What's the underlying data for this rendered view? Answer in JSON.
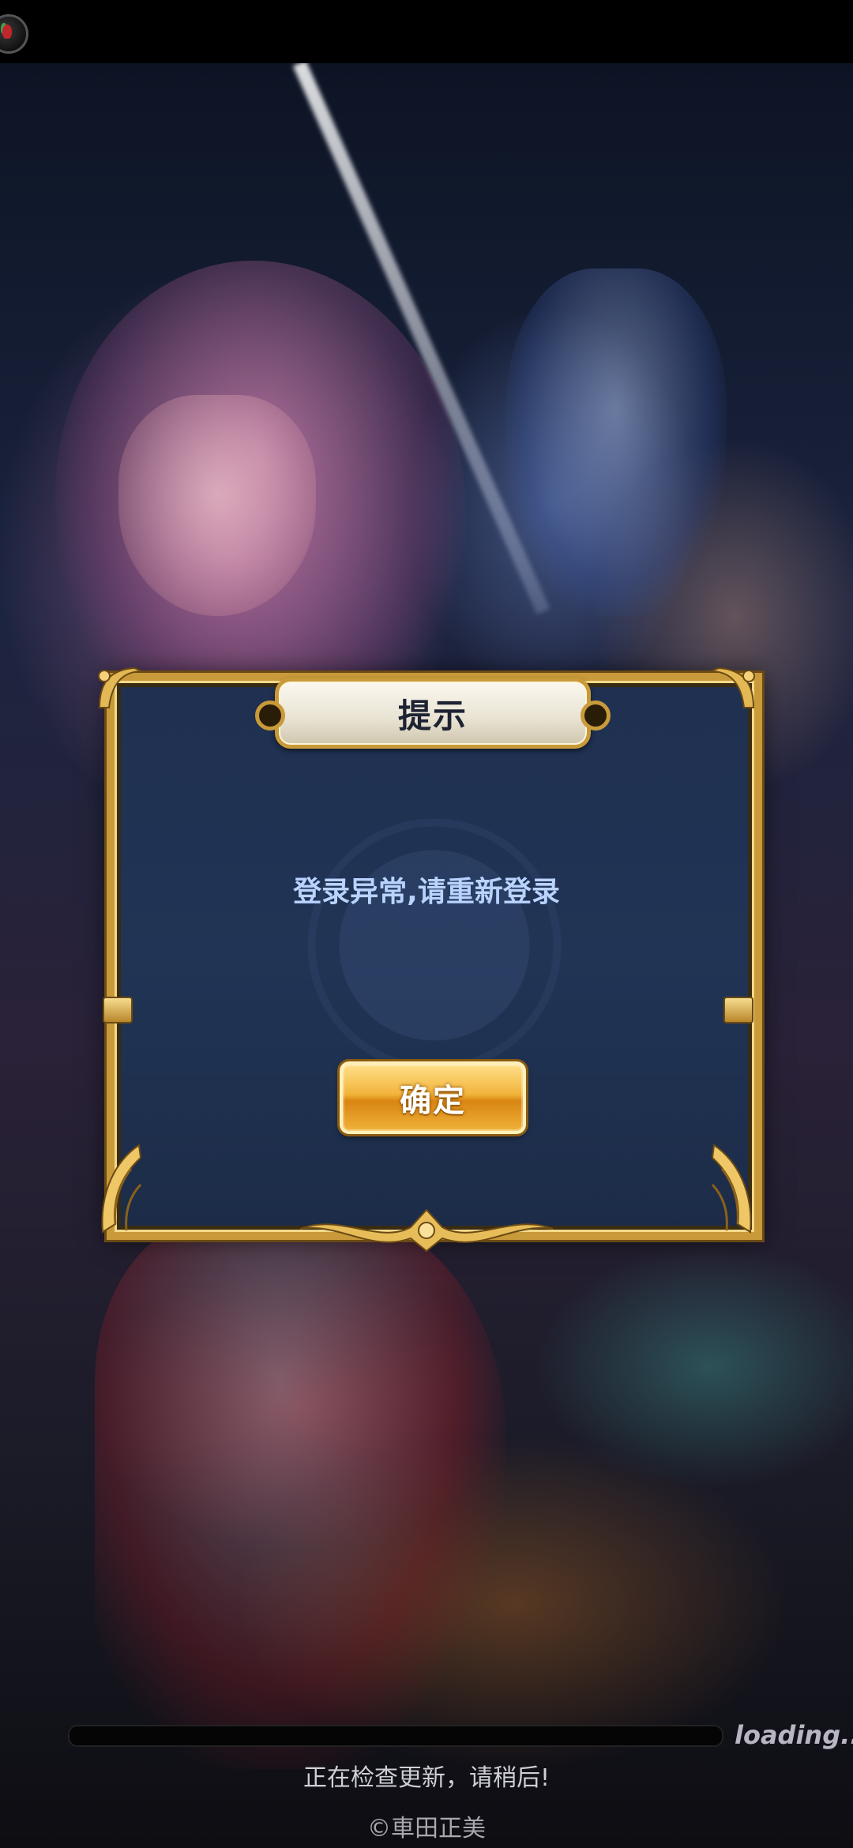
{
  "dialog": {
    "title": "提示",
    "message": "登录异常,请重新登录",
    "confirm_label": "确定"
  },
  "footer": {
    "loading_label": "loading...",
    "progress_percent": 0,
    "status_message": "正在检查更新，请稍后!",
    "copyright": "©車田正美"
  },
  "colors": {
    "dialog_background": "#213455",
    "gold_frame": "#c99a3a",
    "message_text": "#b9d3ff",
    "button_gold": "#f2b33a"
  }
}
